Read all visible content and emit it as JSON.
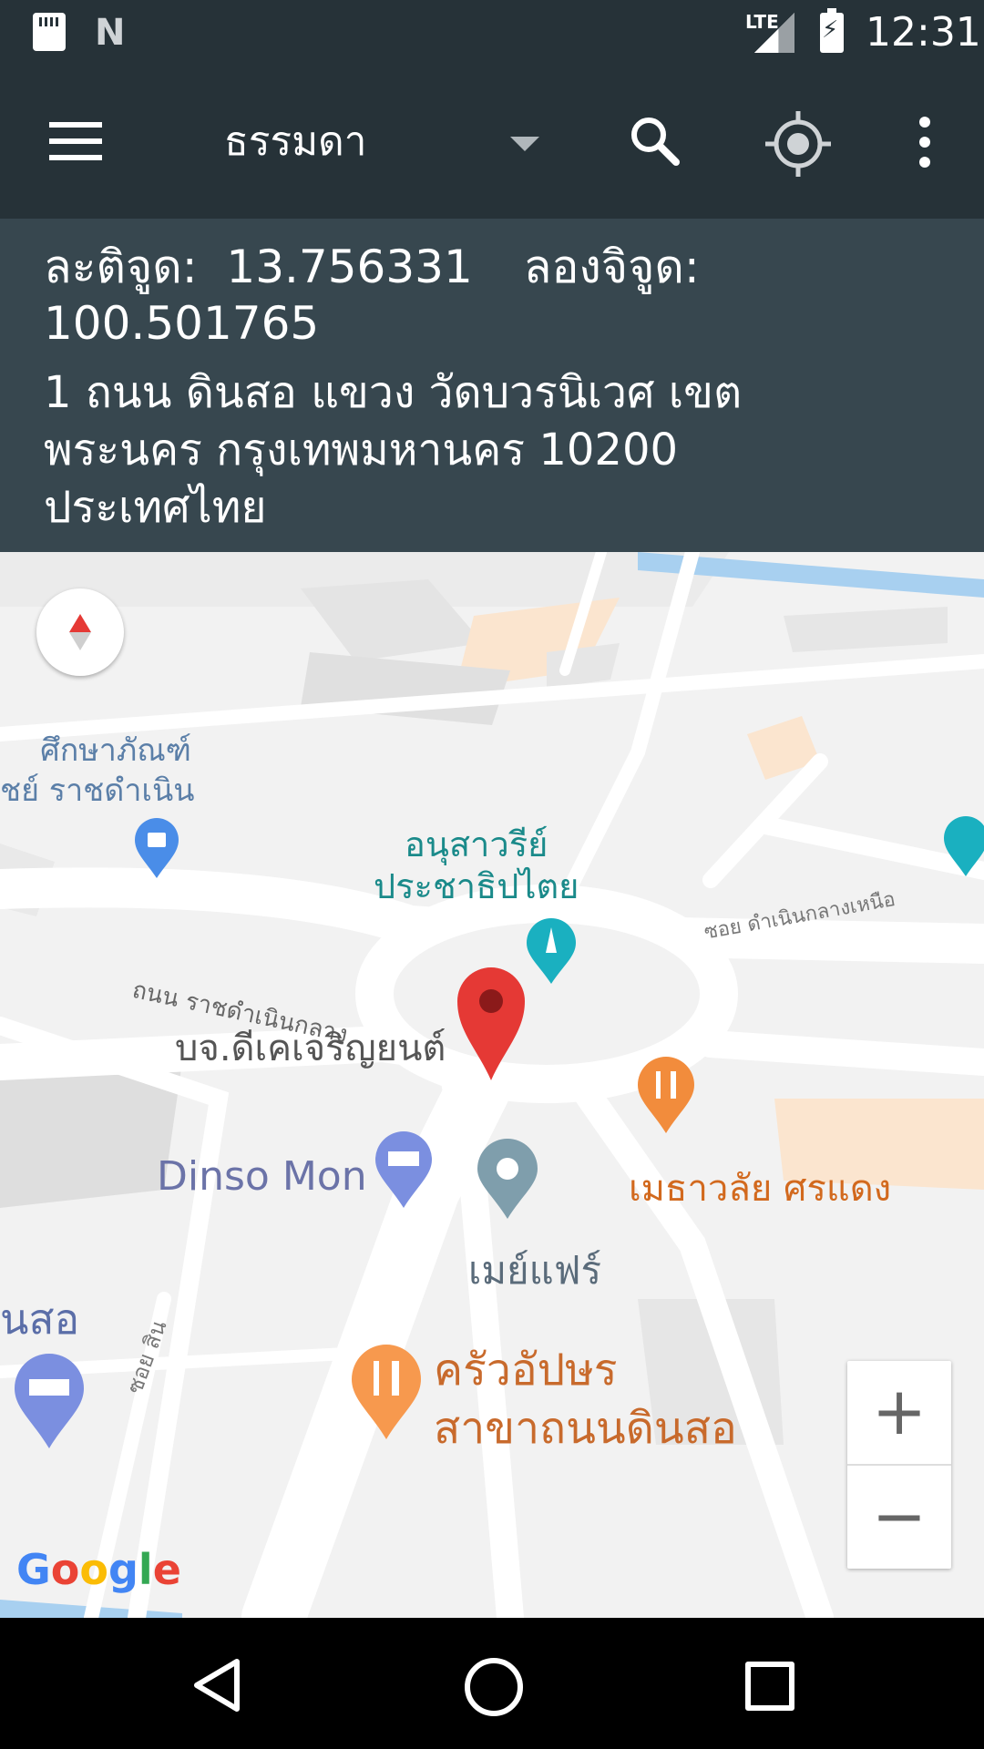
{
  "status_bar": {
    "network": "LTE",
    "time": "12:31"
  },
  "toolbar": {
    "map_type": "ธรรมดา"
  },
  "info": {
    "lat_label": "ละติจูด:",
    "lat_value": "13.756331",
    "lng_label": "ลองจิจูด:",
    "lng_value": "100.501765",
    "address": "1 ถนน ดินสอ แขวง วัดบวรนิเวศ เขต พระนคร กรุงเทพมหานคร 10200 ประเทศไทย"
  },
  "map": {
    "labels": {
      "museum": "ศึกษาภัณฑ์\nชย์ ราชดำเนิน",
      "monument": "อนุสาวรีย์\nประชาธิปไตย",
      "road_ratchadamnoen": "ถนน ราชดำเนินกลาง",
      "soi_damnoen": "ซอย ดำเนินกลางเหนือ",
      "company": "บจ.ดีเคเจริญยนต์",
      "hotel": "Dinso Mon",
      "restaurant1": "เมธาวลัย ศรแดง",
      "mayfair": "เมย์แฟร์",
      "dinso": "นสอ",
      "soi_sin": "ซอย สิน",
      "restaurant2": "ครัวอัปษร\nสาขาถนนดินสอ"
    },
    "zoom_in": "+",
    "zoom_out": "−",
    "attribution": "Google"
  }
}
